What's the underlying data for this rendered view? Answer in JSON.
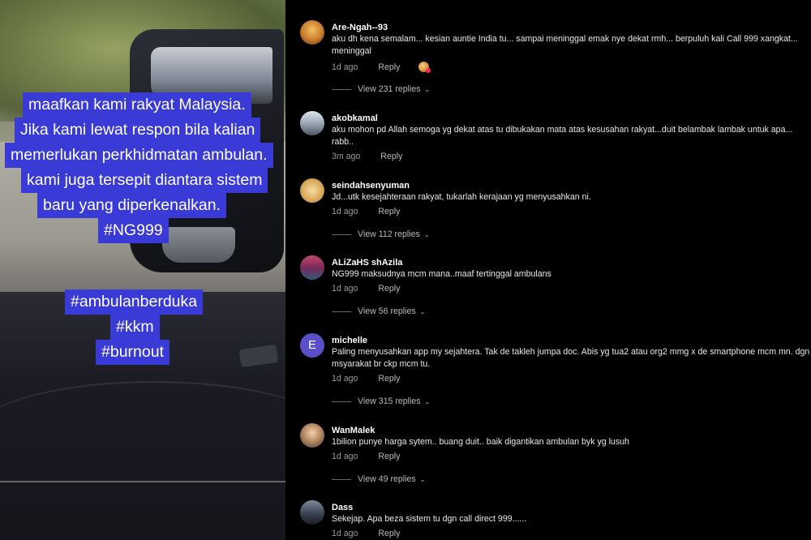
{
  "video": {
    "caption_lines": [
      "maafkan kami rakyat Malaysia.",
      "Jika kami lewat respon bila kalian",
      "memerlukan perkhidmatan ambulan.",
      "kami juga tersepit diantara sistem",
      "baru yang diperkenalkan.",
      "#NG999"
    ],
    "hashtags": [
      "#ambulanberduka",
      "#kkm",
      "#burnout"
    ],
    "caption_color": "#3a3ad6"
  },
  "comments": [
    {
      "username": "Are-Ngah--93",
      "text": "aku dh kena semalam... kesian auntie India tu... sampai meninggal emak nye dekat rmh... berpuluh kali Call 999 xangkat... meninggal",
      "time": "1d ago",
      "reply_label": "Reply",
      "view_replies": "View 231 replies",
      "avatar_icon": "user-avatar-icon"
    },
    {
      "username": "akobkamal",
      "text": "aku mohon pd Allah semoga yg dekat atas tu dibukakan mata atas kesusahan rakyat...duit belambak lambak untuk apa... rabb..",
      "time": "3m ago",
      "reply_label": "Reply",
      "view_replies": "",
      "avatar_icon": "user-avatar-icon"
    },
    {
      "username": "seindahsenyuman",
      "text": "Jd...utk kesejahteraan rakyat, tukarlah kerajaan yg menyusahkan ni.",
      "time": "1d ago",
      "reply_label": "Reply",
      "view_replies": "View 112 replies",
      "avatar_icon": "user-avatar-icon"
    },
    {
      "username": "ALiZaHS shAzila",
      "text": "NG999 maksudnya mcm mana..maaf tertinggal ambulans",
      "time": "1d ago",
      "reply_label": "Reply",
      "view_replies": "View 56 replies",
      "avatar_icon": "user-avatar-icon"
    },
    {
      "username": "michelle",
      "avatar_letter": "E",
      "text": "Paling menyusahkan app my sejahtera. Tak de takleh jumpa doc. Abis yg tua2 atau org2 mmg x de smartphone mcm mn. dgn msyarakat br ckp mcm tu.",
      "time": "1d ago",
      "reply_label": "Reply",
      "view_replies": "View 315 replies",
      "avatar_icon": "letter-avatar-icon"
    },
    {
      "username": "WanMalek",
      "text": "1bilion punye harga sytem.. buang duit.. baik digantikan ambulan byk yg lusuh",
      "time": "1d ago",
      "reply_label": "Reply",
      "view_replies": "View 49 replies",
      "avatar_icon": "user-avatar-icon"
    },
    {
      "username": "Dass",
      "text": "Sekejap. Apa beza sistem tu dgn call direct 999......",
      "time": "1d ago",
      "reply_label": "Reply",
      "view_replies": "",
      "avatar_icon": "user-avatar-icon"
    }
  ],
  "icons": {
    "chevron": "chevron-down-icon",
    "reply_avatar": "creator-avatar-icon"
  }
}
